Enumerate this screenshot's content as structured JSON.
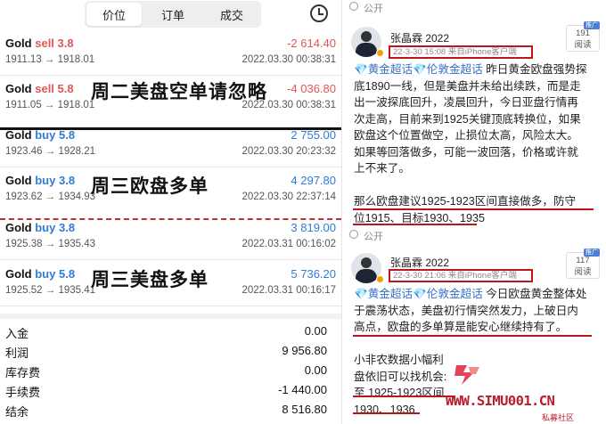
{
  "tabs": [
    {
      "label": "价位",
      "active": true
    },
    {
      "label": "订单",
      "active": false
    },
    {
      "label": "成交",
      "active": false
    }
  ],
  "history_icon": "clock-icon",
  "trades": [
    {
      "symbol": "Gold",
      "action": "sell",
      "volume": "3.8",
      "pnl": "-2 614.40",
      "prices": "1911.13 → 1918.01",
      "time": "2022.03.30 00:38:31"
    },
    {
      "symbol": "Gold",
      "action": "sell",
      "volume": "5.8",
      "pnl": "-4 036.80",
      "prices": "1911.05 → 1918.01",
      "time": "2022.03.30 00:38:31"
    },
    {
      "symbol": "Gold",
      "action": "buy",
      "volume": "5.8",
      "pnl": "2 755.00",
      "prices": "1923.46 → 1928.21",
      "time": "2022.03.30 20:23:32"
    },
    {
      "symbol": "Gold",
      "action": "buy",
      "volume": "3.8",
      "pnl": "4 297.80",
      "prices": "1923.62 → 1934.93",
      "time": "2022.03.30 22:37:14"
    },
    {
      "symbol": "Gold",
      "action": "buy",
      "volume": "3.8",
      "pnl": "3 819.00",
      "prices": "1925.38 → 1935.43",
      "time": "2022.03.31 00:16:02"
    },
    {
      "symbol": "Gold",
      "action": "buy",
      "volume": "5.8",
      "pnl": "5 736.20",
      "prices": "1925.52 → 1935.41",
      "time": "2022.03.31 00:16:17"
    }
  ],
  "annotations": {
    "note1": "周二美盘空单请忽略",
    "note2": "周三欧盘多单",
    "note3": "周三美盘多单"
  },
  "summary": [
    {
      "label": "入金",
      "value": "0.00"
    },
    {
      "label": "利润",
      "value": "9 956.80"
    },
    {
      "label": "库存费",
      "value": "0.00"
    },
    {
      "label": "手续费",
      "value": "-1 440.00"
    },
    {
      "label": "结余",
      "value": "8 516.80"
    }
  ],
  "colors": {
    "sell": "#e05757",
    "buy": "#2f7bd6",
    "highlight": "#c0141b",
    "topic": "#3570c9"
  },
  "posts": [
    {
      "visibility": "公开",
      "author": "张晶霖 2022",
      "meta": "22-3-30 15:08 来自iPhone客户端",
      "reads": "191",
      "reads_label": "阅读",
      "lines": [
        {
          "parts": [
            {
              "t": "💎",
              "c": "gem"
            },
            {
              "t": "黄金超话",
              "c": "tag"
            },
            {
              "t": "💎",
              "c": "gem"
            },
            {
              "t": "伦敦金超话",
              "c": "tag"
            },
            {
              "t": " 昨日黄金欧盘强势探",
              "c": ""
            }
          ]
        },
        {
          "parts": [
            {
              "t": "底1890一线，但是美盘并未给出续跌，而是走",
              "c": ""
            }
          ]
        },
        {
          "parts": [
            {
              "t": "出一波探底回升，凌晨回升，今日亚盘行情再",
              "c": ""
            }
          ]
        },
        {
          "parts": [
            {
              "t": "次走高，目前来到1925关键顶底转换位，如果",
              "c": ""
            }
          ]
        },
        {
          "parts": [
            {
              "t": "欧盘这个位置做空，止损位太高，风险太大。",
              "c": ""
            }
          ]
        },
        {
          "parts": [
            {
              "t": "如果等回落做多，可能一波回落，价格或许就",
              "c": ""
            }
          ]
        },
        {
          "parts": [
            {
              "t": "上不来了。",
              "c": ""
            }
          ]
        },
        {
          "parts": [
            {
              "t": "",
              "c": ""
            }
          ]
        },
        {
          "parts": [
            {
              "t": "那么欧盘建议1925-1923区间直接做多，防守",
              "c": ""
            }
          ]
        },
        {
          "parts": [
            {
              "t": "位1915、目标1930、1935",
              "c": ""
            }
          ]
        }
      ]
    },
    {
      "visibility": "公开",
      "author": "张晶霖 2022",
      "meta": "22-3-30 21:06 来自iPhone客户端",
      "reads": "117",
      "reads_label": "阅读",
      "lines": [
        {
          "parts": [
            {
              "t": "💎",
              "c": "gem"
            },
            {
              "t": "黄金超话",
              "c": "tag"
            },
            {
              "t": "💎",
              "c": "gem"
            },
            {
              "t": "伦敦金超话",
              "c": "tag"
            },
            {
              "t": " 今日欧盘黄金整体处",
              "c": ""
            }
          ]
        },
        {
          "parts": [
            {
              "t": "于震荡状态，美盘初行情突然发力，上破日内",
              "c": ""
            }
          ]
        },
        {
          "parts": [
            {
              "t": "高点，欧盘的多单算是能安心继续持有了。",
              "c": ""
            }
          ]
        },
        {
          "parts": [
            {
              "t": "",
              "c": ""
            }
          ]
        },
        {
          "parts": [
            {
              "t": "小非农数据小幅利",
              "c": ""
            }
          ]
        },
        {
          "parts": [
            {
              "t": "盘依旧可以找机会:",
              "c": ""
            }
          ]
        },
        {
          "parts": [
            {
              "t": "至 1925-1923区间",
              "c": ""
            }
          ]
        },
        {
          "parts": [
            {
              "t": "1930、1936",
              "c": ""
            }
          ]
        }
      ]
    }
  ],
  "watermark": {
    "url": "WWW.SIMU001.CN",
    "sub": "私募社区"
  }
}
